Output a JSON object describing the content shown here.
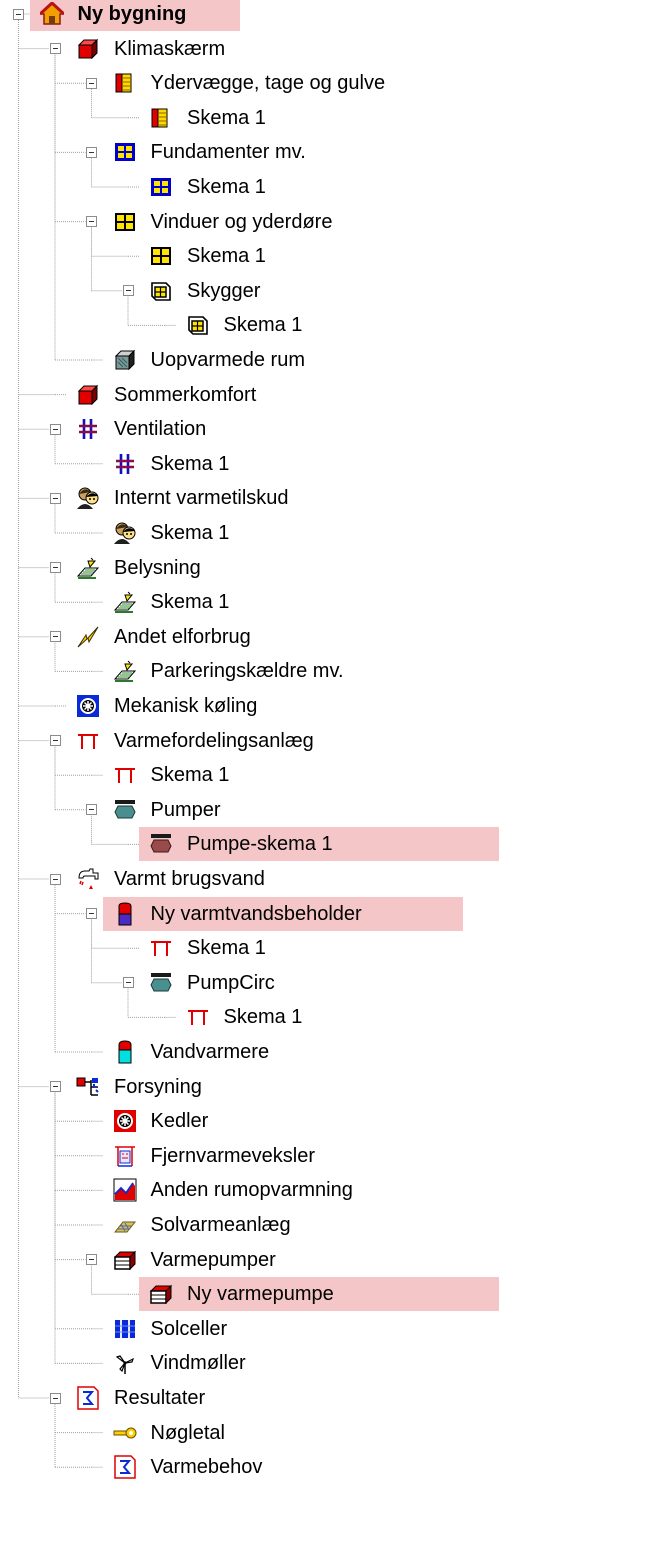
{
  "tree": [
    {
      "label": "Ny bygning",
      "level": 0,
      "toggle": true,
      "icon": "house-icon",
      "bold": true,
      "selected": true
    },
    {
      "label": "Klimaskærm",
      "level": 1,
      "toggle": true,
      "icon": "red-cube-icon"
    },
    {
      "label": "Ydervægge, tage og gulve",
      "level": 2,
      "toggle": true,
      "icon": "wall-layers-icon"
    },
    {
      "label": "Skema 1",
      "level": 3,
      "toggle": false,
      "icon": "wall-layers-icon"
    },
    {
      "label": "Fundamenter mv.",
      "level": 2,
      "toggle": true,
      "icon": "foundation-grid-icon"
    },
    {
      "label": "Skema 1",
      "level": 3,
      "toggle": false,
      "icon": "foundation-grid-icon"
    },
    {
      "label": "Vinduer og yderdøre",
      "level": 2,
      "toggle": true,
      "icon": "window-icon"
    },
    {
      "label": "Skema 1",
      "level": 3,
      "toggle": false,
      "icon": "window-icon"
    },
    {
      "label": "Skygger",
      "level": 3,
      "toggle": true,
      "icon": "shaded-window-icon"
    },
    {
      "label": "Skema 1",
      "level": 4,
      "toggle": false,
      "icon": "shaded-window-icon"
    },
    {
      "label": "Uopvarmede rum",
      "level": 2,
      "toggle": false,
      "icon": "gray-cube-icon"
    },
    {
      "label": "Sommerkomfort",
      "level": 1,
      "toggle": false,
      "icon": "red-cube-icon"
    },
    {
      "label": "Ventilation",
      "level": 1,
      "toggle": true,
      "icon": "ventilation-icon"
    },
    {
      "label": "Skema 1",
      "level": 2,
      "toggle": false,
      "icon": "ventilation-icon"
    },
    {
      "label": "Internt varmetilskud",
      "level": 1,
      "toggle": true,
      "icon": "people-icon"
    },
    {
      "label": "Skema 1",
      "level": 2,
      "toggle": false,
      "icon": "people-icon"
    },
    {
      "label": "Belysning",
      "level": 1,
      "toggle": true,
      "icon": "lighting-icon"
    },
    {
      "label": "Skema 1",
      "level": 2,
      "toggle": false,
      "icon": "lighting-icon"
    },
    {
      "label": "Andet elforbrug",
      "level": 1,
      "toggle": true,
      "icon": "electricity-icon"
    },
    {
      "label": "Parkeringskældre mv.",
      "level": 2,
      "toggle": false,
      "icon": "lighting-icon"
    },
    {
      "label": "Mekanisk køling",
      "level": 1,
      "toggle": false,
      "icon": "cooling-fan-icon"
    },
    {
      "label": "Varmefordelingsanlæg",
      "level": 1,
      "toggle": true,
      "icon": "pipe-icon"
    },
    {
      "label": "Skema 1",
      "level": 2,
      "toggle": false,
      "icon": "pipe-icon"
    },
    {
      "label": "Pumper",
      "level": 2,
      "toggle": true,
      "icon": "pump-icon"
    },
    {
      "label": "Pumpe-skema 1",
      "level": 3,
      "toggle": false,
      "icon": "pump-red-icon",
      "selected": true
    },
    {
      "label": "Varmt brugsvand",
      "level": 1,
      "toggle": true,
      "icon": "faucet-icon"
    },
    {
      "label": "Ny varmtvandsbeholder",
      "level": 2,
      "toggle": true,
      "icon": "water-tank-icon",
      "selected": true
    },
    {
      "label": "Skema 1",
      "level": 3,
      "toggle": false,
      "icon": "pipe-icon"
    },
    {
      "label": "PumpCirc",
      "level": 3,
      "toggle": true,
      "icon": "pump-icon"
    },
    {
      "label": "Skema 1",
      "level": 4,
      "toggle": false,
      "icon": "pipe-icon"
    },
    {
      "label": "Vandvarmere",
      "level": 2,
      "toggle": false,
      "icon": "water-heater-icon"
    },
    {
      "label": "Forsyning",
      "level": 1,
      "toggle": true,
      "icon": "supply-icon"
    },
    {
      "label": "Kedler",
      "level": 2,
      "toggle": false,
      "icon": "boiler-icon"
    },
    {
      "label": "Fjernvarmeveksler",
      "level": 2,
      "toggle": false,
      "icon": "district-heating-icon"
    },
    {
      "label": "Anden rumopvarmning",
      "level": 2,
      "toggle": false,
      "icon": "graph-icon"
    },
    {
      "label": "Solvarmeanlæg",
      "level": 2,
      "toggle": false,
      "icon": "solar-collector-icon"
    },
    {
      "label": "Varmepumper",
      "level": 2,
      "toggle": true,
      "icon": "heat-pump-icon"
    },
    {
      "label": "Ny varmepumpe",
      "level": 3,
      "toggle": false,
      "icon": "heat-pump-icon",
      "selected": true
    },
    {
      "label": "Solceller",
      "level": 2,
      "toggle": false,
      "icon": "solar-cell-icon"
    },
    {
      "label": "Vindmøller",
      "level": 2,
      "toggle": false,
      "icon": "wind-turbine-icon"
    },
    {
      "label": "Resultater",
      "level": 1,
      "toggle": true,
      "icon": "sum-document-icon"
    },
    {
      "label": "Nøgletal",
      "level": 2,
      "toggle": false,
      "icon": "key-icon"
    },
    {
      "label": "Varmebehov",
      "level": 2,
      "toggle": false,
      "icon": "sum-document-icon"
    }
  ],
  "colors": {
    "selection": "#f4c6c8",
    "connector": "#a0a0a0"
  }
}
